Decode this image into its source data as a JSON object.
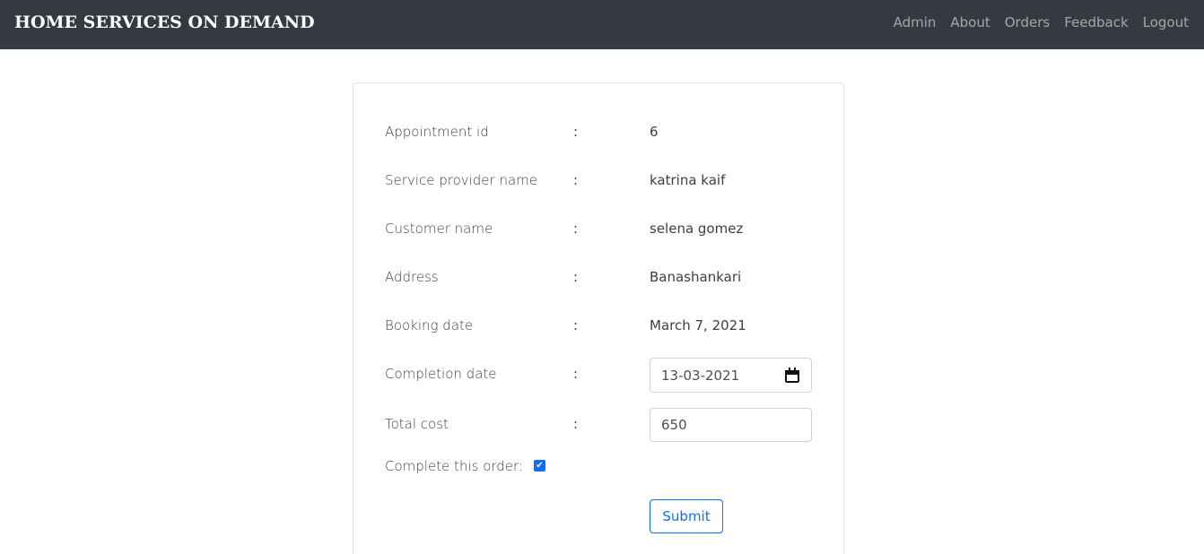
{
  "navbar": {
    "brand": "HOME SERVICES ON DEMAND",
    "links": [
      "Admin",
      "About",
      "Orders",
      "Feedback",
      "Logout"
    ]
  },
  "form": {
    "rows": [
      {
        "label": "Appointment id",
        "colon": ":",
        "value": "6"
      },
      {
        "label": "Service provider name",
        "colon": ":",
        "value": "katrina kaif"
      },
      {
        "label": "Customer name",
        "colon": ":",
        "value": "selena gomez"
      },
      {
        "label": "Address",
        "colon": ":",
        "value": "Banashankari"
      },
      {
        "label": "Booking date",
        "colon": ":",
        "value": "March 7, 2021"
      }
    ],
    "completion_date": {
      "label": "Completion date",
      "colon": ":",
      "value": "13-03-2021"
    },
    "total_cost": {
      "label": "Total cost",
      "colon": ":",
      "value": "650"
    },
    "complete_label": "Complete this order:",
    "complete_checked": true,
    "checkmark": "✔",
    "submit_label": "Submit"
  },
  "colors": {
    "navbar_bg": "#343a40",
    "primary": "#0d6efd"
  }
}
